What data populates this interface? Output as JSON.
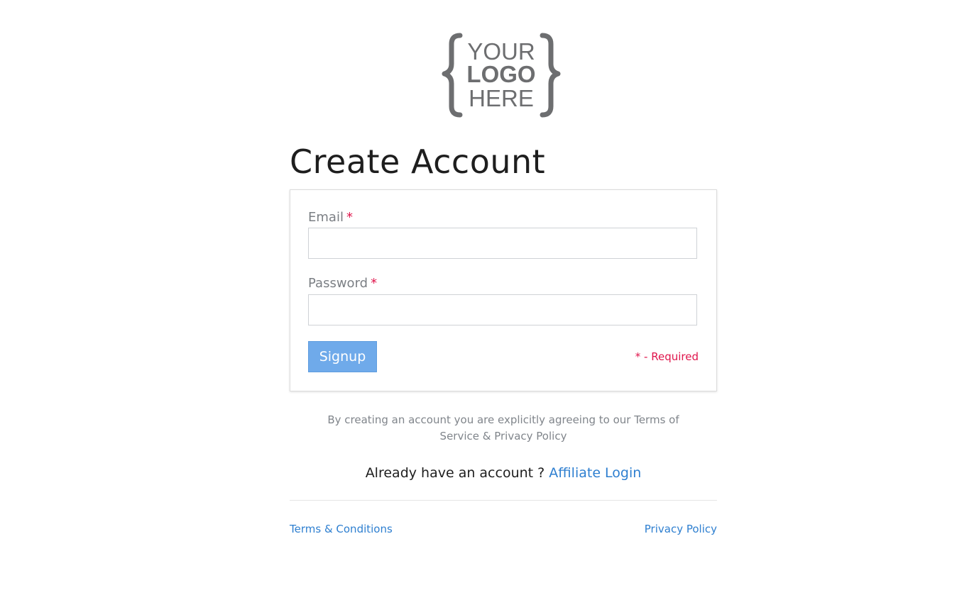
{
  "logo": {
    "line1": "YOUR",
    "line2": "LOGO",
    "line3": "HERE",
    "color": "#6d6e70"
  },
  "title": "Create Account",
  "form": {
    "email_label": "Email",
    "email_value": "",
    "password_label": "Password",
    "password_value": "",
    "required_marker": "*",
    "signup_label": "Signup",
    "required_note": "* - Required"
  },
  "agreement_text": "By creating an account you are explicitly agreeing to our Terms of Service & Privacy Policy",
  "login_prompt": {
    "text": "Already have an account ?",
    "link_label": "Affiliate Login"
  },
  "footer": {
    "terms_label": "Terms & Conditions",
    "privacy_label": "Privacy Policy"
  },
  "colors": {
    "accent_link": "#2e7fd0",
    "button_bg": "#6faaea",
    "required": "#e0154c"
  }
}
